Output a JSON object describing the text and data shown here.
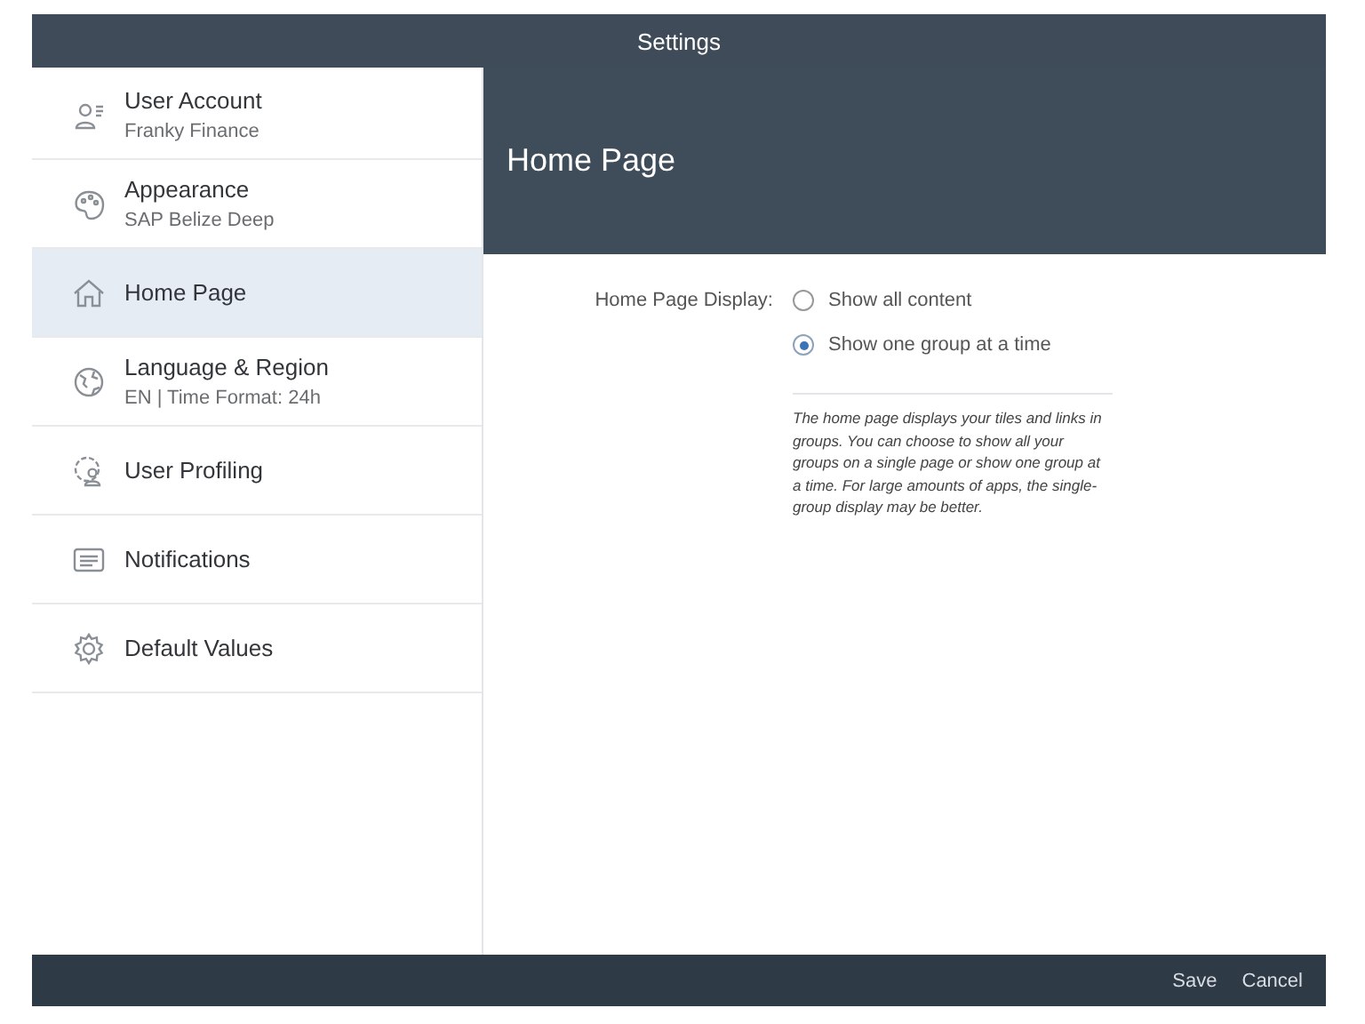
{
  "window": {
    "title": "Settings"
  },
  "sidebar": {
    "items": [
      {
        "label": "User Account",
        "detail": "Franky Finance",
        "selected": false
      },
      {
        "label": "Appearance",
        "detail": "SAP Belize Deep",
        "selected": false
      },
      {
        "label": "Home Page",
        "selected": true
      },
      {
        "label": "Language & Region",
        "detail": "EN | Time Format: 24h",
        "selected": false
      },
      {
        "label": "User Profiling",
        "selected": false
      },
      {
        "label": "Notifications",
        "selected": false
      },
      {
        "label": "Default Values",
        "selected": false
      }
    ]
  },
  "page": {
    "title": "Home Page",
    "field_label": "Home Page Display:",
    "options": [
      {
        "label": "Show all content",
        "selected": false
      },
      {
        "label": "Show one group at a time",
        "selected": true
      }
    ],
    "description": "The home page displays your tiles and links in groups. You can choose to show all your groups on a single page or show one group at a time. For large amounts of apps, the single-group display may be better."
  },
  "footer": {
    "buttons": [
      "Save",
      "Cancel"
    ]
  }
}
